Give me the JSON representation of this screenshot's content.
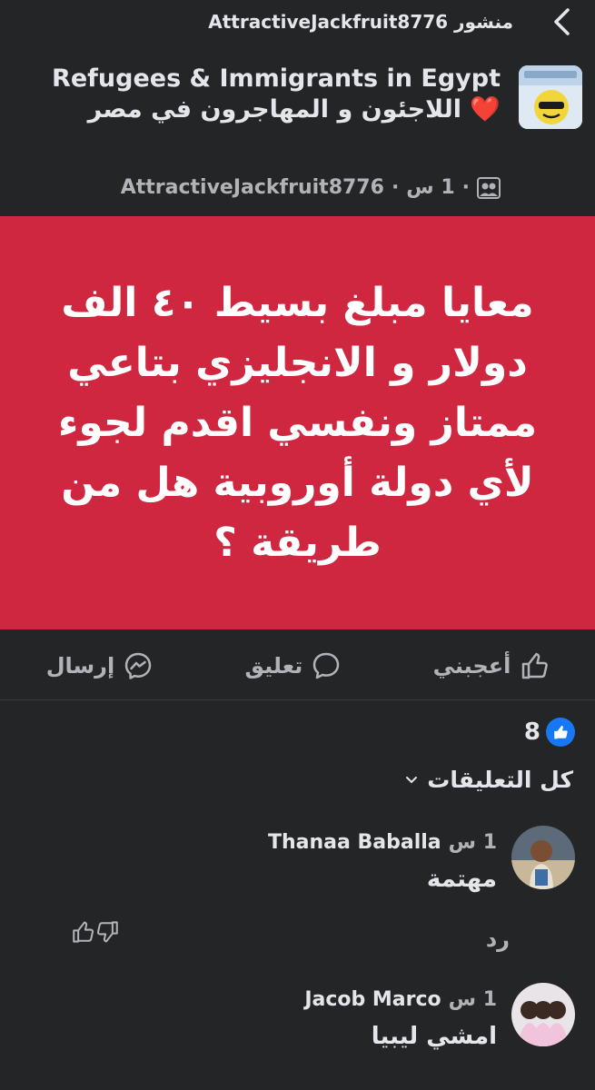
{
  "topbar": {
    "title": "منشور AttractiveJackfruit8776"
  },
  "group": {
    "name": "Refugees & Immigrants in Egypt ❤️ اللاجئون و المهاجرون في مصر",
    "author": "AttractiveJackfruit8776",
    "time": "1 س"
  },
  "post": {
    "text": "معايا مبلغ بسيط ٤٠ الف دولار و الانجليزي بتاعي ممتاز ونفسي اقدم لجوء لأي دولة أوروبية هل من طريقة ؟",
    "background_color": "#cf2740"
  },
  "actions": {
    "like_label": "أعجبني",
    "comment_label": "تعليق",
    "send_label": "إرسال"
  },
  "reactions": {
    "count": "8"
  },
  "comments_filter": {
    "label": "كل التعليقات"
  },
  "comments": [
    {
      "name": "Thanaa Baballa",
      "time": "1 س",
      "text": "مهتمة",
      "reply_label": "رد"
    },
    {
      "name": "Jacob Marco",
      "time": "1 س",
      "text": "امشي ليبيا"
    }
  ],
  "icons": {
    "back": "chevron-left-icon",
    "group_type": "group-icon",
    "like": "thumbs-up-icon",
    "comment": "comment-bubble-icon",
    "send": "messenger-icon",
    "dislike": "thumbs-down-icon"
  },
  "colors": {
    "background": "#242526",
    "accent": "#1877f2",
    "muted": "#b0b3b8"
  }
}
